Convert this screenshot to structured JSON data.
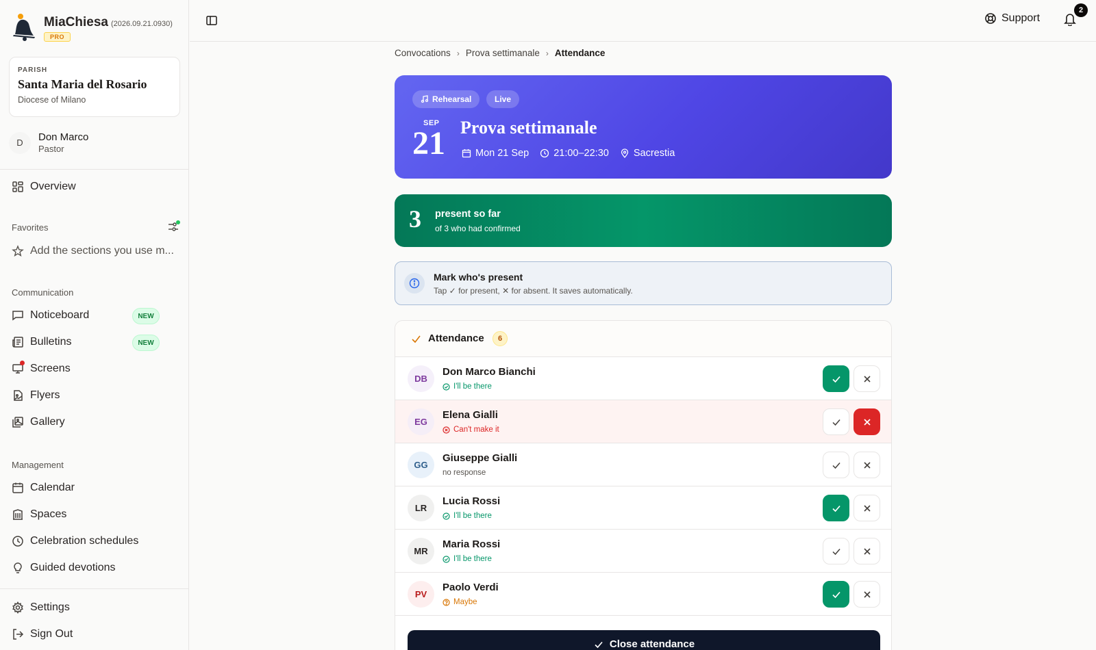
{
  "app": {
    "name": "MiaChiesa",
    "version": "(2026.09.21.0930)",
    "tier": "PRO"
  },
  "parish": {
    "label": "PARISH",
    "name": "Santa Maria del Rosario",
    "diocese": "Diocese of Milano"
  },
  "user": {
    "initial": "D",
    "name": "Don Marco",
    "role": "Pastor"
  },
  "nav": {
    "overview": "Overview",
    "favorites_label": "Favorites",
    "favorites_hint": "Add the sections you use m...",
    "communication_label": "Communication",
    "communication": [
      {
        "label": "Noticeboard",
        "badge": "NEW"
      },
      {
        "label": "Bulletins",
        "badge": "NEW"
      },
      {
        "label": "Screens"
      },
      {
        "label": "Flyers"
      },
      {
        "label": "Gallery"
      }
    ],
    "management_label": "Management",
    "management": [
      {
        "label": "Calendar"
      },
      {
        "label": "Spaces"
      },
      {
        "label": "Celebration schedules"
      },
      {
        "label": "Guided devotions"
      }
    ],
    "settings": "Settings",
    "signout": "Sign Out"
  },
  "topbar": {
    "support": "Support",
    "notifications": "2"
  },
  "breadcrumb": [
    "Convocations",
    "Prova settimanale",
    "Attendance"
  ],
  "event": {
    "tags": [
      "Rehearsal",
      "Live"
    ],
    "month": "SEP",
    "day": "21",
    "title": "Prova settimanale",
    "date": "Mon 21 Sep",
    "time": "21:00–22:30",
    "place": "Sacrestia",
    "accent": "#4f46e5"
  },
  "summary": {
    "count": "3",
    "title": "present so far",
    "subtitle": "of 3 who had confirmed",
    "color": "#047857"
  },
  "info": {
    "title": "Mark who's present",
    "subtitle": "Tap ✓ for present, ✕ for absent. It saves automatically."
  },
  "attendance": {
    "title": "Attendance",
    "count": "6",
    "people": [
      {
        "initials": "DB",
        "name": "Don Marco Bianchi",
        "status": "I'll be there",
        "status_type": "yes",
        "mark": "present"
      },
      {
        "initials": "EG",
        "name": "Elena Gialli",
        "status": "Can't make it",
        "status_type": "no",
        "mark": "absent"
      },
      {
        "initials": "GG",
        "name": "Giuseppe Gialli",
        "status": "no response",
        "status_type": "none",
        "mark": "none"
      },
      {
        "initials": "LR",
        "name": "Lucia Rossi",
        "status": "I'll be there",
        "status_type": "yes",
        "mark": "present"
      },
      {
        "initials": "MR",
        "name": "Maria Rossi",
        "status": "I'll be there",
        "status_type": "yes",
        "mark": "none"
      },
      {
        "initials": "PV",
        "name": "Paolo Verdi",
        "status": "Maybe",
        "status_type": "maybe",
        "mark": "present"
      }
    ],
    "close_label": "Close attendance"
  }
}
